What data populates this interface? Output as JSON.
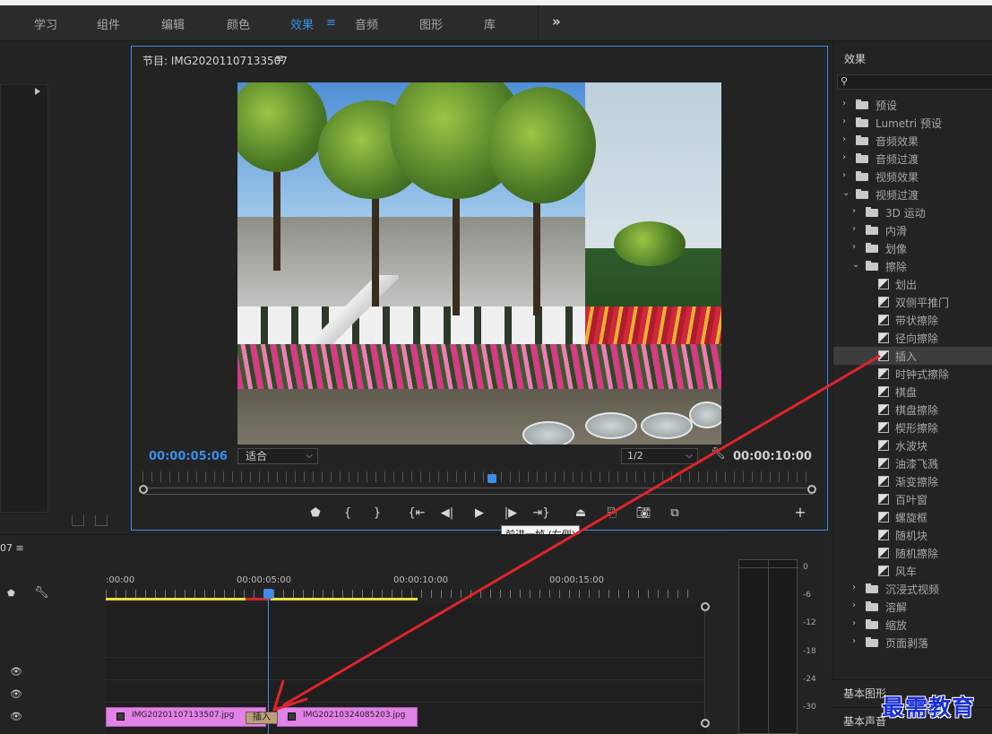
{
  "workspace_bar": {
    "items": [
      "学习",
      "组件",
      "编辑",
      "颜色",
      "效果",
      "音频",
      "图形",
      "库"
    ],
    "active": "效果",
    "menu_icon": "hamburger-icon",
    "more": "»"
  },
  "program_monitor": {
    "title": "节目: IMG20201107133507",
    "menu_icon": "≡",
    "timecode_current": "00:00:05:06",
    "fit_select": "适合",
    "resolution_select": "1/2",
    "timecode_duration": "00:00:10:00",
    "tooltip": "前进一帧 (右侧)",
    "transport_icons": [
      "marker-icon",
      "mark-in-icon",
      "mark-out-icon",
      "go-to-in-icon",
      "step-back-icon",
      "play-icon",
      "step-forward-icon",
      "go-to-out-icon",
      "lift-icon",
      "extract-icon",
      "export-frame-icon",
      "comparison-icon",
      "add-button-icon"
    ]
  },
  "timeline": {
    "title": "07",
    "menu_icon": "≡",
    "timecodes": [
      ":00:00",
      "00:00:05:00",
      "00:00:10:00",
      "00:00:15:00"
    ],
    "clips": [
      {
        "name": "IMG20201107133507.jpg",
        "color": "#e182e6"
      },
      {
        "name": "IMG20210324085203.jpg",
        "color": "#e182e6"
      }
    ],
    "transition_badge": "插入"
  },
  "audio_meter": {
    "db_labels": [
      "0",
      "-6",
      "-12",
      "-18",
      "-24",
      "-30"
    ]
  },
  "effects_panel": {
    "title": "效果",
    "search_icon": "search-icon",
    "items": [
      {
        "label": "预设",
        "level": 0,
        "kind": "folder-special",
        "expanded": false
      },
      {
        "label": "Lumetri 预设",
        "level": 0,
        "kind": "folder-special",
        "expanded": false
      },
      {
        "label": "音频效果",
        "level": 0,
        "kind": "folder",
        "expanded": false
      },
      {
        "label": "音频过渡",
        "level": 0,
        "kind": "folder",
        "expanded": false
      },
      {
        "label": "视频效果",
        "level": 0,
        "kind": "folder",
        "expanded": false
      },
      {
        "label": "视频过渡",
        "level": 0,
        "kind": "folder",
        "expanded": true
      },
      {
        "label": "3D 运动",
        "level": 1,
        "kind": "folder",
        "expanded": false
      },
      {
        "label": "内滑",
        "level": 1,
        "kind": "folder",
        "expanded": false
      },
      {
        "label": "划像",
        "level": 1,
        "kind": "folder",
        "expanded": false
      },
      {
        "label": "擦除",
        "level": 1,
        "kind": "folder",
        "expanded": true
      },
      {
        "label": "划出",
        "level": 2,
        "kind": "transition"
      },
      {
        "label": "双侧平推门",
        "level": 2,
        "kind": "transition"
      },
      {
        "label": "带状擦除",
        "level": 2,
        "kind": "transition"
      },
      {
        "label": "径向擦除",
        "level": 2,
        "kind": "transition"
      },
      {
        "label": "插入",
        "level": 2,
        "kind": "transition",
        "selected": true
      },
      {
        "label": "时钟式擦除",
        "level": 2,
        "kind": "transition"
      },
      {
        "label": "棋盘",
        "level": 2,
        "kind": "transition"
      },
      {
        "label": "棋盘擦除",
        "level": 2,
        "kind": "transition"
      },
      {
        "label": "楔形擦除",
        "level": 2,
        "kind": "transition"
      },
      {
        "label": "水波块",
        "level": 2,
        "kind": "transition"
      },
      {
        "label": "油漆飞溅",
        "level": 2,
        "kind": "transition"
      },
      {
        "label": "渐变擦除",
        "level": 2,
        "kind": "transition"
      },
      {
        "label": "百叶窗",
        "level": 2,
        "kind": "transition"
      },
      {
        "label": "螺旋框",
        "level": 2,
        "kind": "transition"
      },
      {
        "label": "随机块",
        "level": 2,
        "kind": "transition"
      },
      {
        "label": "随机擦除",
        "level": 2,
        "kind": "transition"
      },
      {
        "label": "风车",
        "level": 2,
        "kind": "transition"
      },
      {
        "label": "沉浸式视频",
        "level": 1,
        "kind": "folder",
        "expanded": false
      },
      {
        "label": "溶解",
        "level": 1,
        "kind": "folder",
        "expanded": false
      },
      {
        "label": "缩放",
        "level": 1,
        "kind": "folder",
        "expanded": false
      },
      {
        "label": "页面剥落",
        "level": 1,
        "kind": "folder",
        "expanded": false
      }
    ]
  },
  "side_panels": {
    "basic_graphics": "基本图形",
    "basic_audio": "基本声音"
  },
  "annotation": {
    "arrow_color": "#e0242c"
  },
  "watermark": "最需教育"
}
